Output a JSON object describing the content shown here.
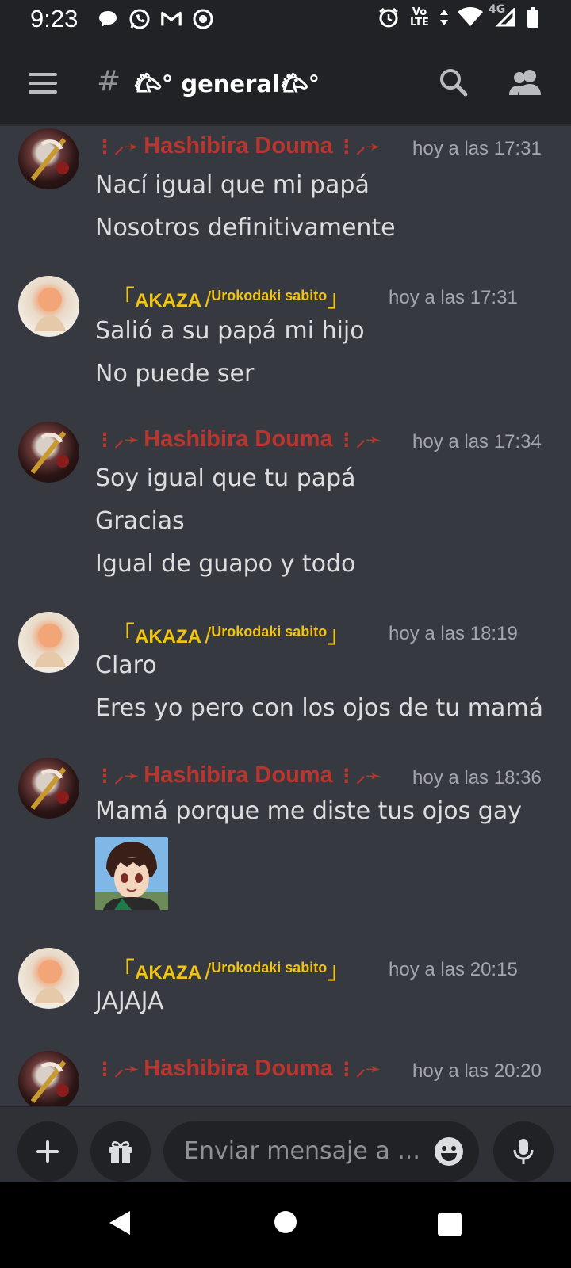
{
  "status_bar": {
    "time": "9:23",
    "left_icons": [
      "chat-bubble-icon",
      "whatsapp-icon",
      "gmail-icon",
      "record-icon"
    ],
    "right_icons": [
      "alarm-icon",
      "volte-icon",
      "data-arrows-icon",
      "wifi-icon",
      "signal-icon",
      "battery-icon"
    ],
    "volte_top": "Vo",
    "volte_bottom": "LTE",
    "network": "4G"
  },
  "header": {
    "hash": "#",
    "channel": "𐂃° general𐂃°"
  },
  "messages": [
    {
      "author": "douma",
      "deco_left": "⋮⸝➛",
      "name": "Hashibira Douma",
      "deco_right": "⋮⸝➛",
      "time": "hoy a las 17:31",
      "lines": [
        "Nací igual que mi papá",
        "Nosotros definitivamente"
      ]
    },
    {
      "author": "akaza",
      "bracket_open": "「",
      "name_main": "AKAZA",
      "slash": "/",
      "name_sub": "Urokodaki sabito",
      "bracket_close": "」",
      "time": "hoy a las 17:31",
      "lines": [
        "Salió a su papá mi hijo",
        "No puede ser"
      ]
    },
    {
      "author": "douma",
      "deco_left": "⋮⸝➛",
      "name": "Hashibira Douma",
      "deco_right": "⋮⸝➛",
      "time": "hoy a las 17:34",
      "lines": [
        "Soy igual que tu papá",
        "Gracias",
        "Igual de guapo y todo"
      ]
    },
    {
      "author": "akaza",
      "bracket_open": "「",
      "name_main": "AKAZA",
      "slash": "/",
      "name_sub": "Urokodaki sabito",
      "bracket_close": "」",
      "time": "hoy a las 18:19",
      "lines": [
        "Claro",
        "Eres yo pero con los ojos de tu mamá"
      ]
    },
    {
      "author": "douma",
      "deco_left": "⋮⸝➛",
      "name": "Hashibira Douma",
      "deco_right": "⋮⸝➛",
      "time": "hoy a las 18:36",
      "lines": [
        "Mamá porque me diste tus ojos gay"
      ],
      "attachment": "anime-sticker-image"
    },
    {
      "author": "akaza",
      "bracket_open": "「",
      "name_main": "AKAZA",
      "slash": "/",
      "name_sub": "Urokodaki sabito",
      "bracket_close": "」",
      "time": "hoy a las 20:15",
      "lines": [
        "JAJAJA"
      ]
    },
    {
      "author": "douma",
      "deco_left": "⋮⸝➛",
      "name": "Hashibira Douma",
      "deco_right": "⋮⸝➛",
      "time": "hoy a las 20:20",
      "lines": []
    }
  ],
  "composer": {
    "placeholder": "Enviar mensaje a ...",
    "buttons": [
      "plus-icon",
      "gift-icon",
      "emoji-icon",
      "microphone-icon"
    ]
  },
  "colors": {
    "background": "#36393f",
    "bars": "#202225",
    "douma_name": "#b8362e",
    "akaza_name": "#f1c40f",
    "timestamp": "#a3a6aa",
    "text": "#dcddde"
  }
}
